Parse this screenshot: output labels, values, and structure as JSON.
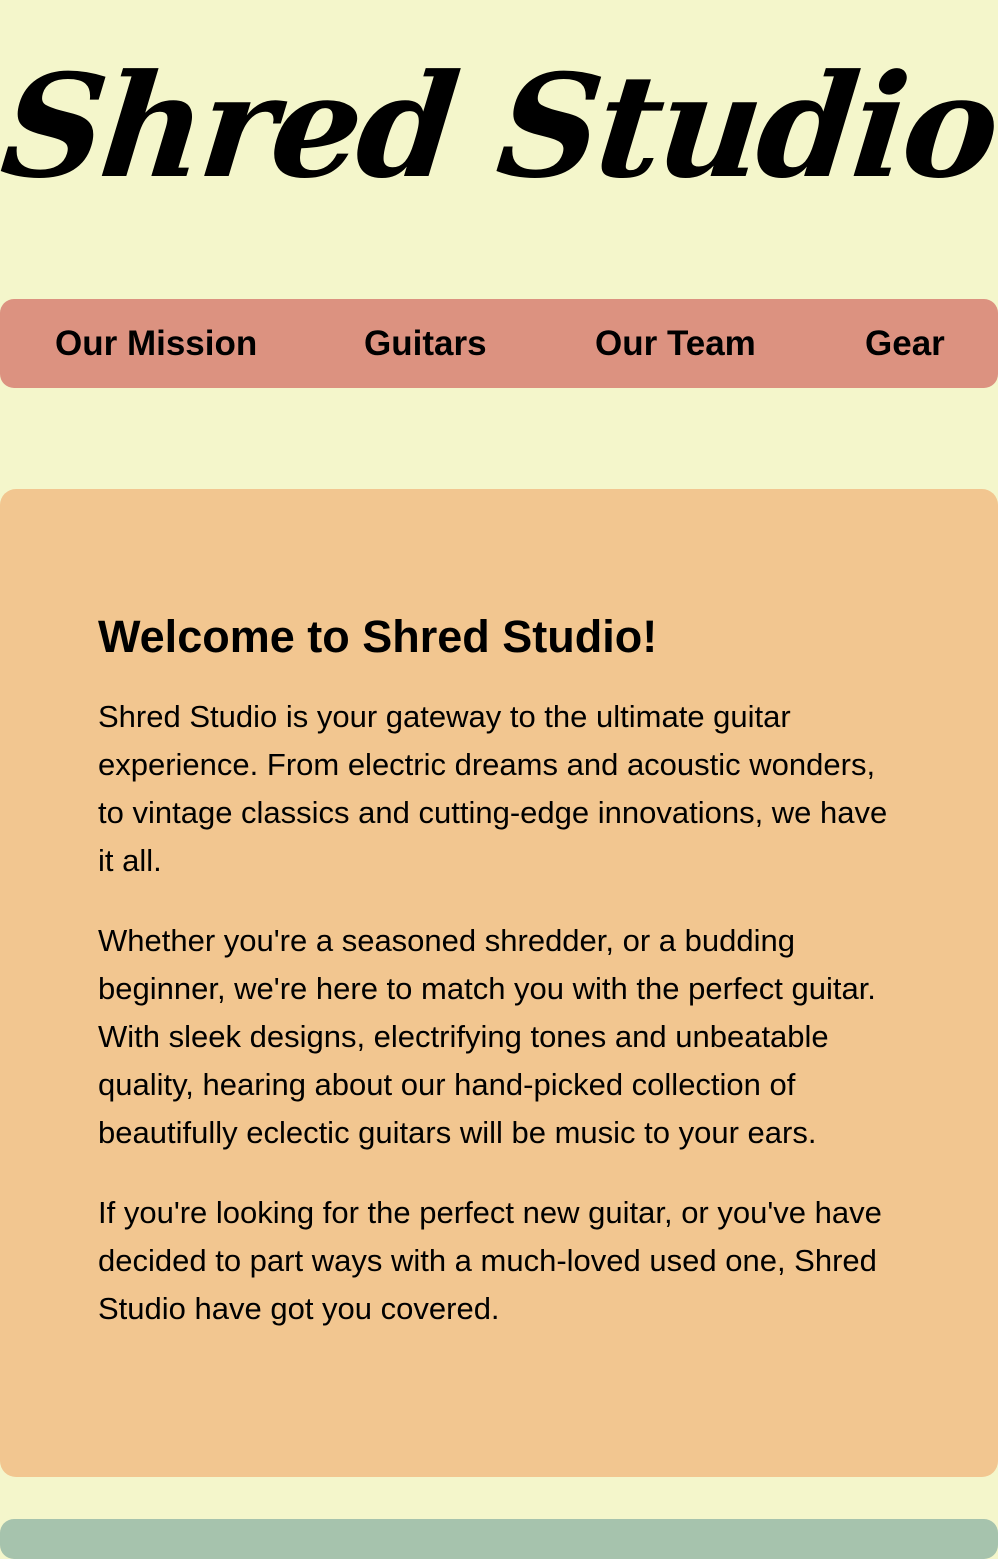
{
  "header": {
    "title": "Shred Studio"
  },
  "nav": {
    "items": [
      {
        "label": "Our Mission"
      },
      {
        "label": "Guitars"
      },
      {
        "label": "Our Team"
      },
      {
        "label": "Gear"
      }
    ]
  },
  "main": {
    "heading": "Welcome to Shred Studio!",
    "paragraphs": [
      "Shred Studio is your gateway to the ultimate guitar experience. From electric dreams and acoustic wonders, to vintage classics and cutting-edge innovations, we have it all.",
      "Whether you're a seasoned shredder, or a budding beginner, we're here to match you with the perfect guitar. With sleek designs, electrifying tones and unbeatable quality, hearing about our hand-picked collection of beautifully eclectic guitars will be music to your ears.",
      "If you're looking for the perfect new guitar, or you've have decided to part ways with a much-loved used one, Shred Studio have got you covered."
    ]
  },
  "colors": {
    "page_background": "#f4f6cb",
    "nav_background": "#dc9280",
    "content_background": "#f2c690",
    "next_section_background": "#a6c3ad"
  }
}
